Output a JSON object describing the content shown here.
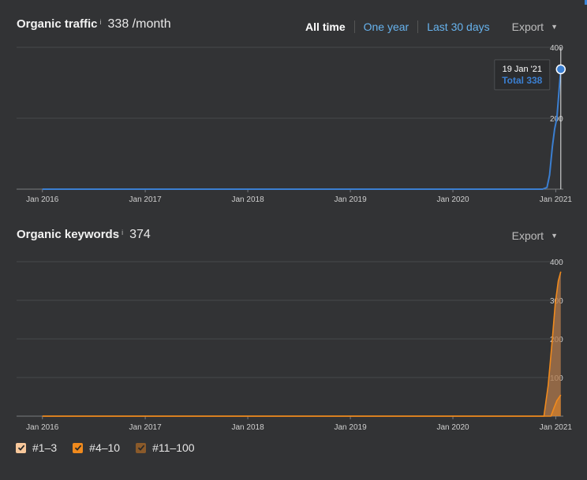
{
  "traffic": {
    "title": "Organic traffic",
    "info": "i",
    "value": "338 /month",
    "ranges": [
      "All time",
      "One year",
      "Last 30 days"
    ],
    "export": "Export",
    "tooltip": {
      "date": "19 Jan '21",
      "total": "Total 338"
    }
  },
  "keywords": {
    "title": "Organic keywords",
    "info": "i",
    "value": "374",
    "export": "Export",
    "legend": [
      "#1–3",
      "#4–10",
      "#11–100"
    ]
  },
  "colors": {
    "background": "#323335",
    "traffic_line": "#3b7fd1",
    "kw_1_3": "#f8c89b",
    "kw_4_10": "#f08a1d",
    "kw_11_100": "#8a5a2a"
  },
  "chart_data": [
    {
      "type": "line",
      "title": "Organic traffic",
      "x_ticks": [
        "Jan 2016",
        "Jan 2017",
        "Jan 2018",
        "Jan 2019",
        "Jan 2020",
        "Jan 2021"
      ],
      "y_ticks": [
        200,
        400
      ],
      "ylim": [
        0,
        400
      ],
      "grid": true,
      "series": [
        {
          "values": [
            {
              "x": "2016-01-01",
              "y": 0
            },
            {
              "x": "2020-11-15",
              "y": 0
            },
            {
              "x": "2020-12-01",
              "y": 5
            },
            {
              "x": "2020-12-10",
              "y": 40
            },
            {
              "x": "2020-12-20",
              "y": 120
            },
            {
              "x": "2020-12-28",
              "y": 170
            },
            {
              "x": "2021-01-05",
              "y": 200
            },
            {
              "x": "2021-01-12",
              "y": 270
            },
            {
              "x": "2021-01-19",
              "y": 338
            }
          ]
        }
      ]
    },
    {
      "type": "area",
      "title": "Organic keywords",
      "x_ticks": [
        "Jan 2016",
        "Jan 2017",
        "Jan 2018",
        "Jan 2019",
        "Jan 2020",
        "Jan 2021"
      ],
      "y_ticks": [
        100,
        200,
        300,
        400
      ],
      "ylim": [
        0,
        400
      ],
      "grid": true,
      "legend": "bottom-left",
      "series": [
        {
          "name": "#4–10",
          "values": [
            {
              "x": "2016-01-01",
              "y": 0
            },
            {
              "x": "2020-12-15",
              "y": 0
            },
            {
              "x": "2020-12-25",
              "y": 20
            },
            {
              "x": "2021-01-05",
              "y": 40
            },
            {
              "x": "2021-01-19",
              "y": 55
            }
          ]
        },
        {
          "name": "#11–100",
          "values": [
            {
              "x": "2016-01-01",
              "y": 0
            },
            {
              "x": "2020-11-20",
              "y": 0
            },
            {
              "x": "2020-12-05",
              "y": 80
            },
            {
              "x": "2020-12-20",
              "y": 200
            },
            {
              "x": "2020-12-30",
              "y": 290
            },
            {
              "x": "2021-01-10",
              "y": 350
            },
            {
              "x": "2021-01-19",
              "y": 374
            }
          ]
        }
      ]
    }
  ]
}
